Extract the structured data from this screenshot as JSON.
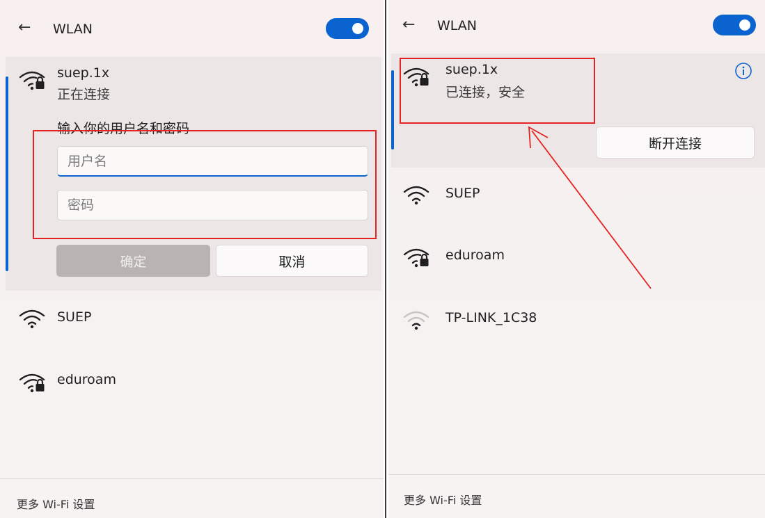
{
  "left": {
    "header": {
      "back_icon": "←",
      "title": "WLAN",
      "toggle_on": true
    },
    "connecting": {
      "name": "suep.1x",
      "status": "正在连接",
      "prompt": "输入你的用户名和密码",
      "username_placeholder": "用户名",
      "password_placeholder": "密码",
      "ok_label": "确定",
      "cancel_label": "取消"
    },
    "networks": [
      {
        "name": "SUEP",
        "secured": false,
        "strength": "full"
      },
      {
        "name": "eduroam",
        "secured": true,
        "strength": "full"
      }
    ],
    "footer": "更多 Wi-Fi 设置"
  },
  "right": {
    "header": {
      "back_icon": "←",
      "title": "WLAN",
      "toggle_on": true
    },
    "connected": {
      "name": "suep.1x",
      "status": "已连接，安全",
      "disconnect_label": "断开连接"
    },
    "networks": [
      {
        "name": "SUEP",
        "secured": false,
        "strength": "full"
      },
      {
        "name": "eduroam",
        "secured": true,
        "strength": "full"
      },
      {
        "name": "TP-LINK_1C38",
        "secured": false,
        "strength": "weak"
      }
    ],
    "footer": "更多 Wi-Fi 设置"
  },
  "colors": {
    "accent": "#0b63d0",
    "annotation": "#e52222"
  },
  "icons": {
    "wifi": "wifi-icon",
    "wifi_secured": "wifi-lock-icon",
    "info": "info-icon",
    "back": "back-arrow-icon"
  }
}
